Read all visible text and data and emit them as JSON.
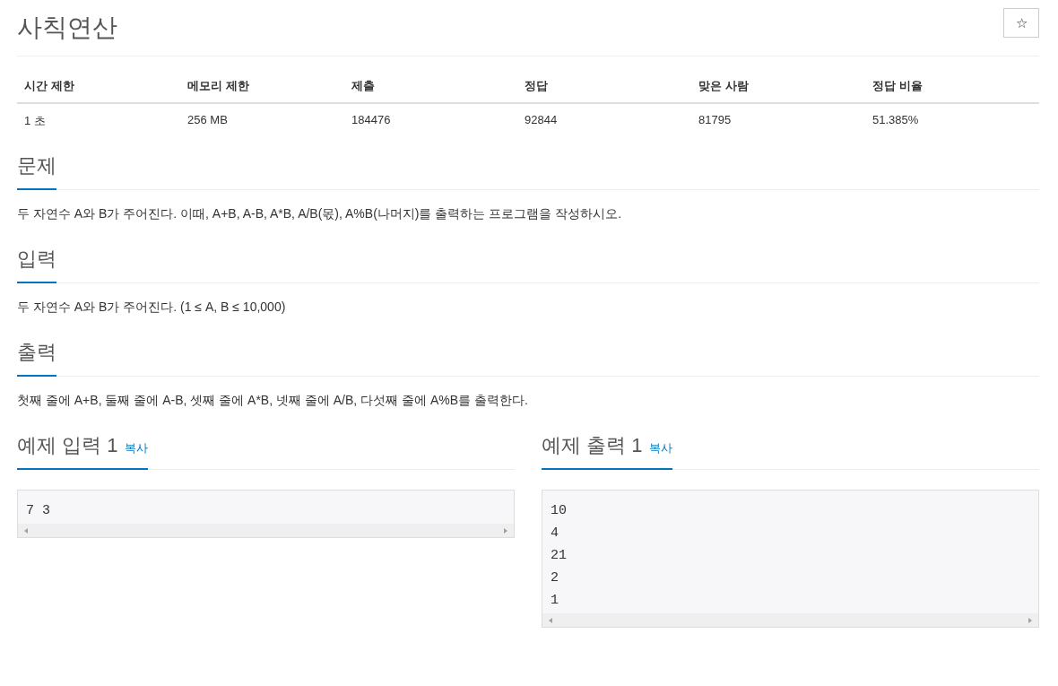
{
  "title": "사칙연산",
  "star_button": "☆",
  "info_table": {
    "columns": [
      "시간 제한",
      "메모리 제한",
      "제출",
      "정답",
      "맞은 사람",
      "정답 비율"
    ],
    "rows": [
      [
        "1 초",
        "256 MB",
        "184476",
        "92844",
        "81795",
        "51.385%"
      ]
    ]
  },
  "sections": [
    {
      "heading": "문제",
      "text": "두 자연수 A와 B가 주어진다. 이때, A+B, A-B, A*B, A/B(몫), A%B(나머지)를 출력하는 프로그램을 작성하시오."
    },
    {
      "heading": "입력",
      "text": "두 자연수 A와 B가 주어진다. (1 ≤ A, B ≤ 10,000)"
    },
    {
      "heading": "출력",
      "text": "첫째 줄에 A+B, 둘째 줄에 A-B, 셋째 줄에 A*B, 넷째 줄에 A/B, 다섯째 줄에 A%B를 출력한다."
    }
  ],
  "samples": [
    {
      "heading": "예제 입력 1",
      "copy": "복사",
      "lines": [
        "7 3"
      ]
    },
    {
      "heading": "예제 출력 1",
      "copy": "복사",
      "lines": [
        "10",
        "4",
        "21",
        "2",
        "1"
      ]
    }
  ]
}
